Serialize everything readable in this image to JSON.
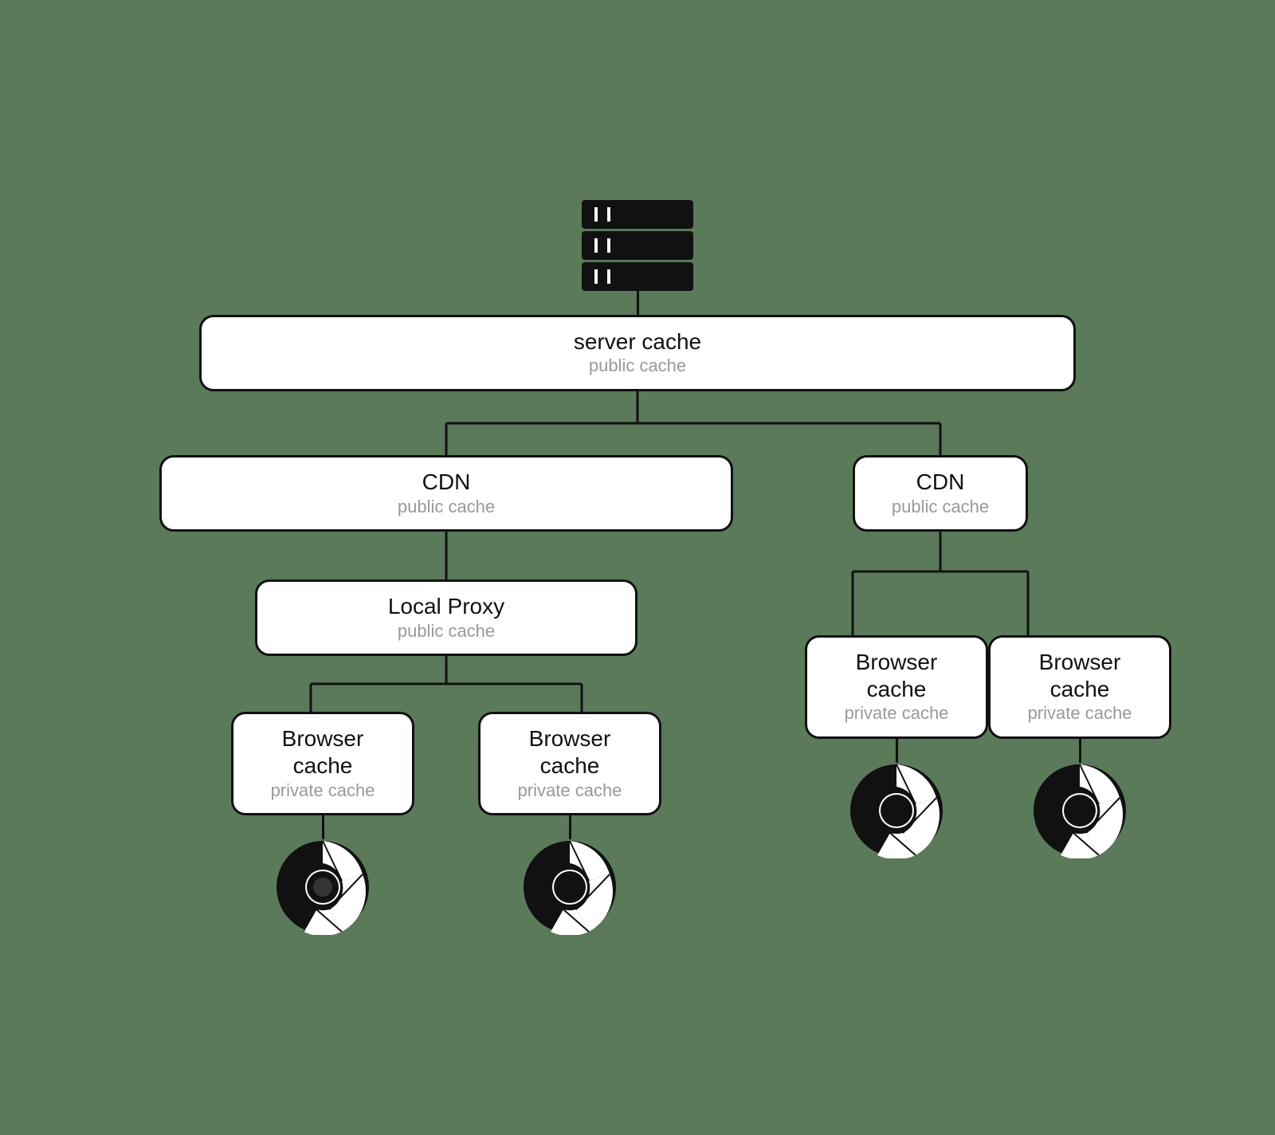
{
  "diagram": {
    "background": "#5a7a5a",
    "server": {
      "title": "server cache",
      "subtitle": "public cache"
    },
    "cdn_left": {
      "title": "CDN",
      "subtitle": "public cache"
    },
    "cdn_right": {
      "title": "CDN",
      "subtitle": "public cache"
    },
    "local_proxy": {
      "title": "Local Proxy",
      "subtitle": "public cache"
    },
    "browser_caches": [
      {
        "title": "Browser cache",
        "subtitle": "private cache"
      },
      {
        "title": "Browser cache",
        "subtitle": "private cache"
      },
      {
        "title": "Browser cache",
        "subtitle": "private cache"
      },
      {
        "title": "Browser cache",
        "subtitle": "private cache"
      }
    ]
  }
}
